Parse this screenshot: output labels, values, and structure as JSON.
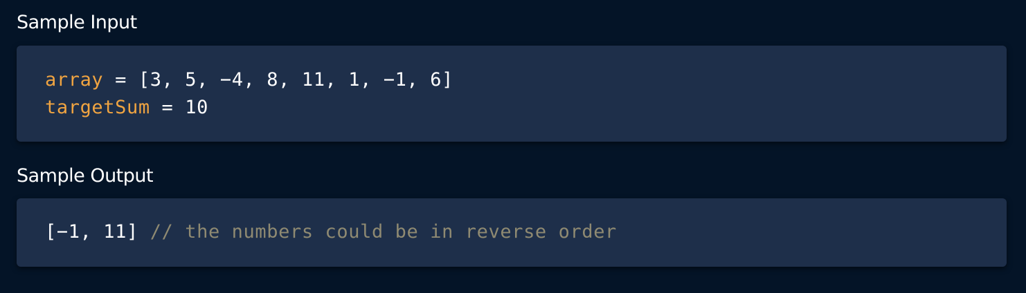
{
  "input": {
    "heading": "Sample Input",
    "lines": [
      {
        "name": "array",
        "op": " = ",
        "value": "[3, 5, −4, 8, 11, 1, −1, 6]"
      },
      {
        "name": "targetSum",
        "op": " = ",
        "value": "10"
      }
    ]
  },
  "output": {
    "heading": "Sample Output",
    "value": "[−1, 11]",
    "comment": " // the numbers could be in reverse order"
  },
  "colors": {
    "background": "#041427",
    "code_bg": "#1e2f4a",
    "variable": "#f0a441",
    "comment": "#8f8a72"
  }
}
